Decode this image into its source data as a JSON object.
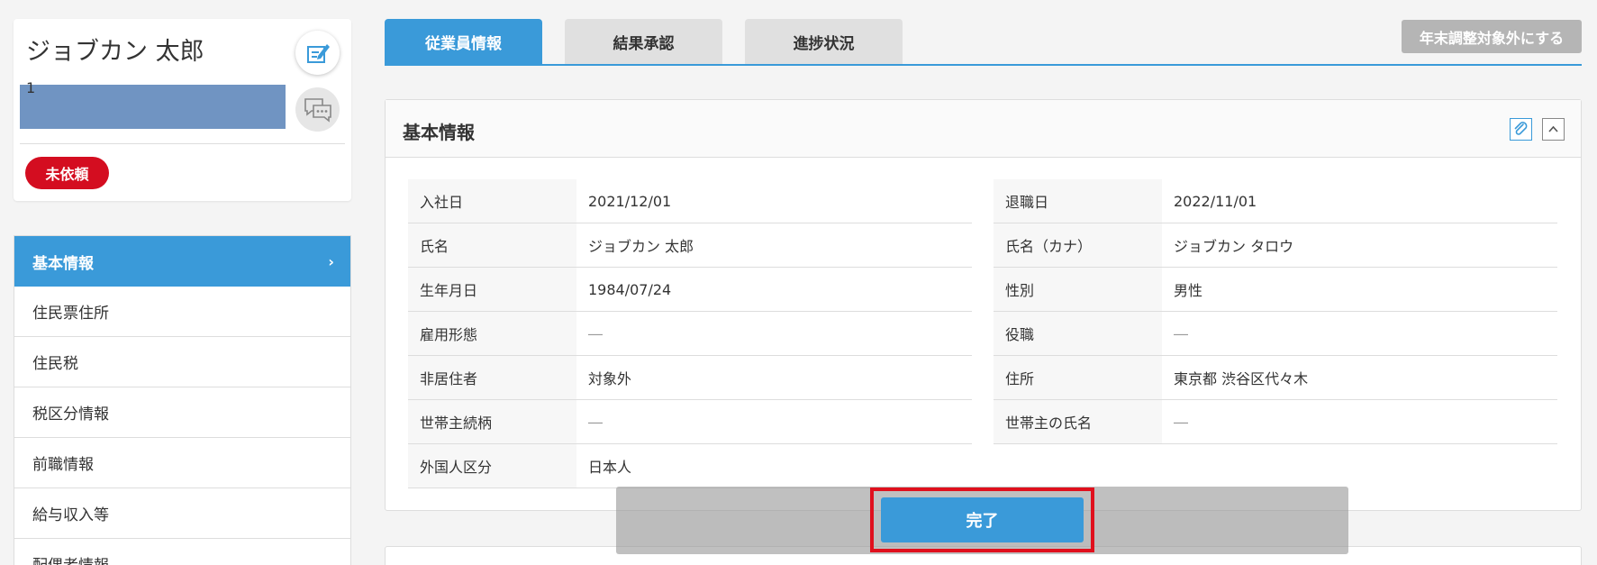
{
  "profile": {
    "name": "ジョブカン 太郎",
    "id": "1",
    "status": "未依頼",
    "colors": {
      "bar": "#7094c2",
      "badge": "#d40d20"
    }
  },
  "sidebar": {
    "items": [
      {
        "label": "基本情報",
        "active": true
      },
      {
        "label": "住民票住所"
      },
      {
        "label": "住民税"
      },
      {
        "label": "税区分情報"
      },
      {
        "label": "前職情報"
      },
      {
        "label": "給与収入等"
      },
      {
        "label": "配偶者情報"
      }
    ]
  },
  "tabs": [
    {
      "label": "従業員情報",
      "active": true
    },
    {
      "label": "結果承認"
    },
    {
      "label": "進捗状況"
    }
  ],
  "header": {
    "exclude_button": "年末調整対象外にする"
  },
  "panel": {
    "title": "基本情報",
    "left_rows": [
      {
        "label": "入社日",
        "value": "2021/12/01"
      },
      {
        "label": "氏名",
        "value": "ジョブカン 太郎"
      },
      {
        "label": "生年月日",
        "value": "1984/07/24"
      },
      {
        "label": "雇用形態",
        "value": "―"
      },
      {
        "label": "非居住者",
        "value": "対象外"
      },
      {
        "label": "世帯主続柄",
        "value": "―"
      },
      {
        "label": "外国人区分",
        "value": "日本人"
      }
    ],
    "right_rows": [
      {
        "label": "退職日",
        "value": "2022/11/01"
      },
      {
        "label": "氏名（カナ）",
        "value": "ジョブカン タロウ"
      },
      {
        "label": "性別",
        "value": "男性"
      },
      {
        "label": "役職",
        "value": "―"
      },
      {
        "label": "住所",
        "value": "東京都 渋谷区代々木"
      },
      {
        "label": "世帯主の氏名",
        "value": "―"
      }
    ]
  },
  "actions": {
    "complete": "完了"
  },
  "colors": {
    "accent": "#3a9ad9",
    "highlight": "#e0101d"
  }
}
